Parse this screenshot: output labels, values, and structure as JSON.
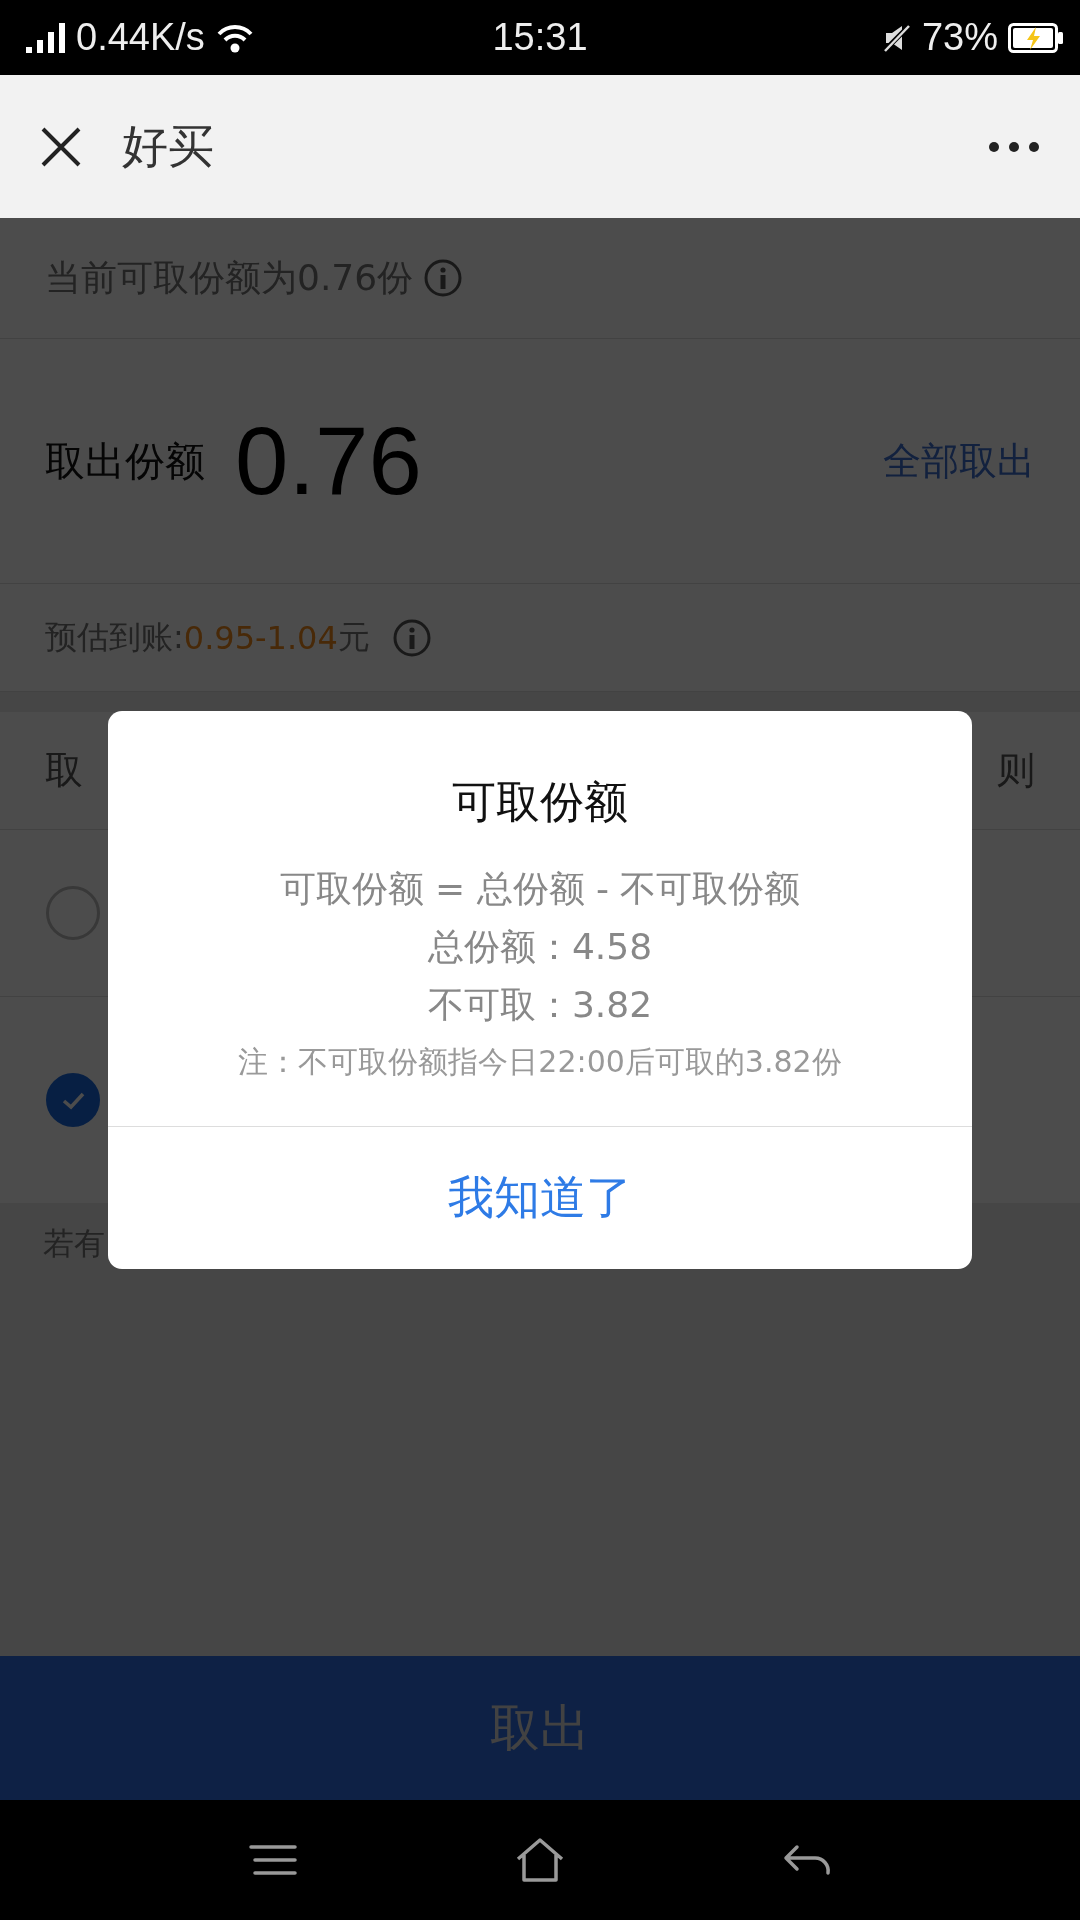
{
  "status_bar": {
    "speed": "0.44K/s",
    "time": "15:31",
    "battery": "73%"
  },
  "header": {
    "title": "好买"
  },
  "available": {
    "text": "当前可取份额为0.76份"
  },
  "amount": {
    "label": "取出份额",
    "value": "0.76",
    "action": "全部取出"
  },
  "estimate": {
    "label": "预估到账:",
    "value": "0.95-1.04",
    "unit": "元"
  },
  "method": {
    "label": "取",
    "link": "则"
  },
  "options": [
    {
      "selected": false
    },
    {
      "selected": true
    }
  ],
  "note": "若有",
  "submit": "取出",
  "dialog": {
    "title": "可取份额",
    "lines": [
      "可取份额 = 总份额 - 不可取份额",
      "总份额：4.58",
      "不可取：3.82"
    ],
    "note": "注：不可取份额指今日22:00后可取的3.82份",
    "button": "我知道了"
  }
}
